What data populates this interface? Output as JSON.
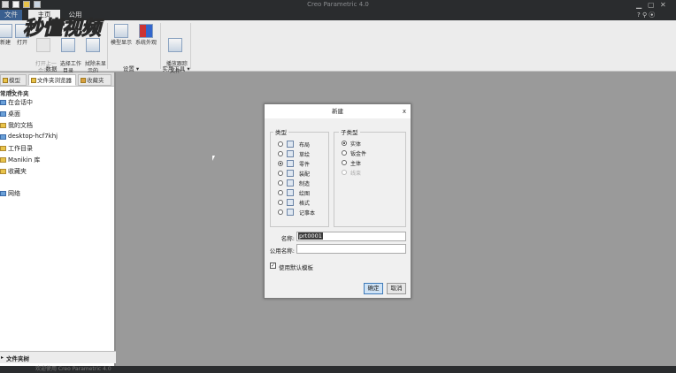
{
  "app": {
    "title": "Creo Parametric 4.0"
  },
  "watermark": "秒懂视频",
  "tabs": [
    {
      "label": "文件"
    },
    {
      "label": "主页"
    },
    {
      "label": "公用"
    }
  ],
  "ribbon": {
    "buttons": [
      {
        "label": "新建",
        "icon": "new-icon"
      },
      {
        "label": "打开",
        "icon": "open-icon"
      },
      {
        "label": "打开上一\n会话",
        "icon": "open-last-session-icon"
      },
      {
        "label": "选择工作\n目录",
        "icon": "select-working-dir-icon"
      },
      {
        "label": "拭除未显\n示的",
        "icon": "erase-not-displayed-icon"
      },
      {
        "label": "模型显示",
        "icon": "model-display-icon"
      },
      {
        "label": "系统外观",
        "icon": "system-appearance-icon"
      },
      {
        "label": "播放跟踪\n文件",
        "icon": "play-trail-icon"
      }
    ],
    "groups": [
      {
        "label": "数据"
      },
      {
        "label": "设置 ▾"
      },
      {
        "label": "实用工具 ▾"
      }
    ]
  },
  "left_panel": {
    "tabs": [
      {
        "label": "模型树"
      },
      {
        "label": "文件夹浏览器"
      },
      {
        "label": "收藏夹"
      }
    ],
    "section_title": "常用文件夹",
    "items": [
      {
        "label": "在会话中"
      },
      {
        "label": "桌面"
      },
      {
        "label": "我的文档"
      },
      {
        "label": "desktop-hcf7khj"
      },
      {
        "label": "工作目录"
      },
      {
        "label": "Manikin 库"
      },
      {
        "label": "收藏夹"
      },
      {
        "label": "网络"
      }
    ],
    "bottom_section": "文件夹树"
  },
  "status_bar": {
    "text": "欢迎使用 Creo Parametric 4.0"
  },
  "dialog": {
    "title": "新建",
    "close": "x",
    "type_legend": "类型",
    "subtype_legend": "子类型",
    "types": [
      {
        "label": "布局",
        "selected": false
      },
      {
        "label": "草绘",
        "selected": false
      },
      {
        "label": "零件",
        "selected": true
      },
      {
        "label": "装配",
        "selected": false
      },
      {
        "label": "制造",
        "selected": false
      },
      {
        "label": "绘图",
        "selected": false
      },
      {
        "label": "格式",
        "selected": false
      },
      {
        "label": "记事本",
        "selected": false
      }
    ],
    "subtypes": [
      {
        "label": "实体",
        "selected": true,
        "disabled": false
      },
      {
        "label": "钣金件",
        "selected": false,
        "disabled": false
      },
      {
        "label": "主体",
        "selected": false,
        "disabled": false
      },
      {
        "label": "线束",
        "selected": false,
        "disabled": true
      }
    ],
    "name_label": "名称:",
    "name_value": "prt0001",
    "common_name_label": "公用名称:",
    "common_name_value": "",
    "use_template_label": "使用默认模板",
    "use_template_checked": true,
    "ok_label": "确定",
    "cancel_label": "取消"
  }
}
